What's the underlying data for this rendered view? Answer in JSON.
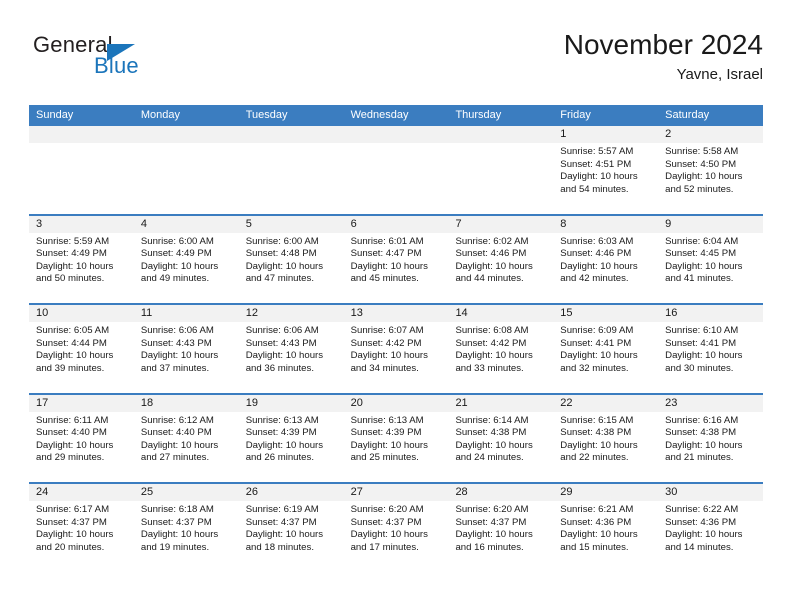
{
  "brand": {
    "name_top": "General",
    "name_bottom": "Blue",
    "color_dark": "#231f20",
    "color_blue": "#1b75bb"
  },
  "header": {
    "title": "November 2024",
    "location": "Yavne, Israel"
  },
  "theme": {
    "header_row_bg": "#3b7dc0",
    "daynum_bg": "#f2f2f2",
    "cell_bg": "#ffffff",
    "text": "#1a1a1a"
  },
  "weekdays": [
    "Sunday",
    "Monday",
    "Tuesday",
    "Wednesday",
    "Thursday",
    "Friday",
    "Saturday"
  ],
  "weeks": [
    [
      {
        "day": "",
        "sunrise": "",
        "sunset": "",
        "daylight1": "",
        "daylight2": ""
      },
      {
        "day": "",
        "sunrise": "",
        "sunset": "",
        "daylight1": "",
        "daylight2": ""
      },
      {
        "day": "",
        "sunrise": "",
        "sunset": "",
        "daylight1": "",
        "daylight2": ""
      },
      {
        "day": "",
        "sunrise": "",
        "sunset": "",
        "daylight1": "",
        "daylight2": ""
      },
      {
        "day": "",
        "sunrise": "",
        "sunset": "",
        "daylight1": "",
        "daylight2": ""
      },
      {
        "day": "1",
        "sunrise": "Sunrise: 5:57 AM",
        "sunset": "Sunset: 4:51 PM",
        "daylight1": "Daylight: 10 hours",
        "daylight2": "and 54 minutes."
      },
      {
        "day": "2",
        "sunrise": "Sunrise: 5:58 AM",
        "sunset": "Sunset: 4:50 PM",
        "daylight1": "Daylight: 10 hours",
        "daylight2": "and 52 minutes."
      }
    ],
    [
      {
        "day": "3",
        "sunrise": "Sunrise: 5:59 AM",
        "sunset": "Sunset: 4:49 PM",
        "daylight1": "Daylight: 10 hours",
        "daylight2": "and 50 minutes."
      },
      {
        "day": "4",
        "sunrise": "Sunrise: 6:00 AM",
        "sunset": "Sunset: 4:49 PM",
        "daylight1": "Daylight: 10 hours",
        "daylight2": "and 49 minutes."
      },
      {
        "day": "5",
        "sunrise": "Sunrise: 6:00 AM",
        "sunset": "Sunset: 4:48 PM",
        "daylight1": "Daylight: 10 hours",
        "daylight2": "and 47 minutes."
      },
      {
        "day": "6",
        "sunrise": "Sunrise: 6:01 AM",
        "sunset": "Sunset: 4:47 PM",
        "daylight1": "Daylight: 10 hours",
        "daylight2": "and 45 minutes."
      },
      {
        "day": "7",
        "sunrise": "Sunrise: 6:02 AM",
        "sunset": "Sunset: 4:46 PM",
        "daylight1": "Daylight: 10 hours",
        "daylight2": "and 44 minutes."
      },
      {
        "day": "8",
        "sunrise": "Sunrise: 6:03 AM",
        "sunset": "Sunset: 4:46 PM",
        "daylight1": "Daylight: 10 hours",
        "daylight2": "and 42 minutes."
      },
      {
        "day": "9",
        "sunrise": "Sunrise: 6:04 AM",
        "sunset": "Sunset: 4:45 PM",
        "daylight1": "Daylight: 10 hours",
        "daylight2": "and 41 minutes."
      }
    ],
    [
      {
        "day": "10",
        "sunrise": "Sunrise: 6:05 AM",
        "sunset": "Sunset: 4:44 PM",
        "daylight1": "Daylight: 10 hours",
        "daylight2": "and 39 minutes."
      },
      {
        "day": "11",
        "sunrise": "Sunrise: 6:06 AM",
        "sunset": "Sunset: 4:43 PM",
        "daylight1": "Daylight: 10 hours",
        "daylight2": "and 37 minutes."
      },
      {
        "day": "12",
        "sunrise": "Sunrise: 6:06 AM",
        "sunset": "Sunset: 4:43 PM",
        "daylight1": "Daylight: 10 hours",
        "daylight2": "and 36 minutes."
      },
      {
        "day": "13",
        "sunrise": "Sunrise: 6:07 AM",
        "sunset": "Sunset: 4:42 PM",
        "daylight1": "Daylight: 10 hours",
        "daylight2": "and 34 minutes."
      },
      {
        "day": "14",
        "sunrise": "Sunrise: 6:08 AM",
        "sunset": "Sunset: 4:42 PM",
        "daylight1": "Daylight: 10 hours",
        "daylight2": "and 33 minutes."
      },
      {
        "day": "15",
        "sunrise": "Sunrise: 6:09 AM",
        "sunset": "Sunset: 4:41 PM",
        "daylight1": "Daylight: 10 hours",
        "daylight2": "and 32 minutes."
      },
      {
        "day": "16",
        "sunrise": "Sunrise: 6:10 AM",
        "sunset": "Sunset: 4:41 PM",
        "daylight1": "Daylight: 10 hours",
        "daylight2": "and 30 minutes."
      }
    ],
    [
      {
        "day": "17",
        "sunrise": "Sunrise: 6:11 AM",
        "sunset": "Sunset: 4:40 PM",
        "daylight1": "Daylight: 10 hours",
        "daylight2": "and 29 minutes."
      },
      {
        "day": "18",
        "sunrise": "Sunrise: 6:12 AM",
        "sunset": "Sunset: 4:40 PM",
        "daylight1": "Daylight: 10 hours",
        "daylight2": "and 27 minutes."
      },
      {
        "day": "19",
        "sunrise": "Sunrise: 6:13 AM",
        "sunset": "Sunset: 4:39 PM",
        "daylight1": "Daylight: 10 hours",
        "daylight2": "and 26 minutes."
      },
      {
        "day": "20",
        "sunrise": "Sunrise: 6:13 AM",
        "sunset": "Sunset: 4:39 PM",
        "daylight1": "Daylight: 10 hours",
        "daylight2": "and 25 minutes."
      },
      {
        "day": "21",
        "sunrise": "Sunrise: 6:14 AM",
        "sunset": "Sunset: 4:38 PM",
        "daylight1": "Daylight: 10 hours",
        "daylight2": "and 24 minutes."
      },
      {
        "day": "22",
        "sunrise": "Sunrise: 6:15 AM",
        "sunset": "Sunset: 4:38 PM",
        "daylight1": "Daylight: 10 hours",
        "daylight2": "and 22 minutes."
      },
      {
        "day": "23",
        "sunrise": "Sunrise: 6:16 AM",
        "sunset": "Sunset: 4:38 PM",
        "daylight1": "Daylight: 10 hours",
        "daylight2": "and 21 minutes."
      }
    ],
    [
      {
        "day": "24",
        "sunrise": "Sunrise: 6:17 AM",
        "sunset": "Sunset: 4:37 PM",
        "daylight1": "Daylight: 10 hours",
        "daylight2": "and 20 minutes."
      },
      {
        "day": "25",
        "sunrise": "Sunrise: 6:18 AM",
        "sunset": "Sunset: 4:37 PM",
        "daylight1": "Daylight: 10 hours",
        "daylight2": "and 19 minutes."
      },
      {
        "day": "26",
        "sunrise": "Sunrise: 6:19 AM",
        "sunset": "Sunset: 4:37 PM",
        "daylight1": "Daylight: 10 hours",
        "daylight2": "and 18 minutes."
      },
      {
        "day": "27",
        "sunrise": "Sunrise: 6:20 AM",
        "sunset": "Sunset: 4:37 PM",
        "daylight1": "Daylight: 10 hours",
        "daylight2": "and 17 minutes."
      },
      {
        "day": "28",
        "sunrise": "Sunrise: 6:20 AM",
        "sunset": "Sunset: 4:37 PM",
        "daylight1": "Daylight: 10 hours",
        "daylight2": "and 16 minutes."
      },
      {
        "day": "29",
        "sunrise": "Sunrise: 6:21 AM",
        "sunset": "Sunset: 4:36 PM",
        "daylight1": "Daylight: 10 hours",
        "daylight2": "and 15 minutes."
      },
      {
        "day": "30",
        "sunrise": "Sunrise: 6:22 AM",
        "sunset": "Sunset: 4:36 PM",
        "daylight1": "Daylight: 10 hours",
        "daylight2": "and 14 minutes."
      }
    ]
  ]
}
